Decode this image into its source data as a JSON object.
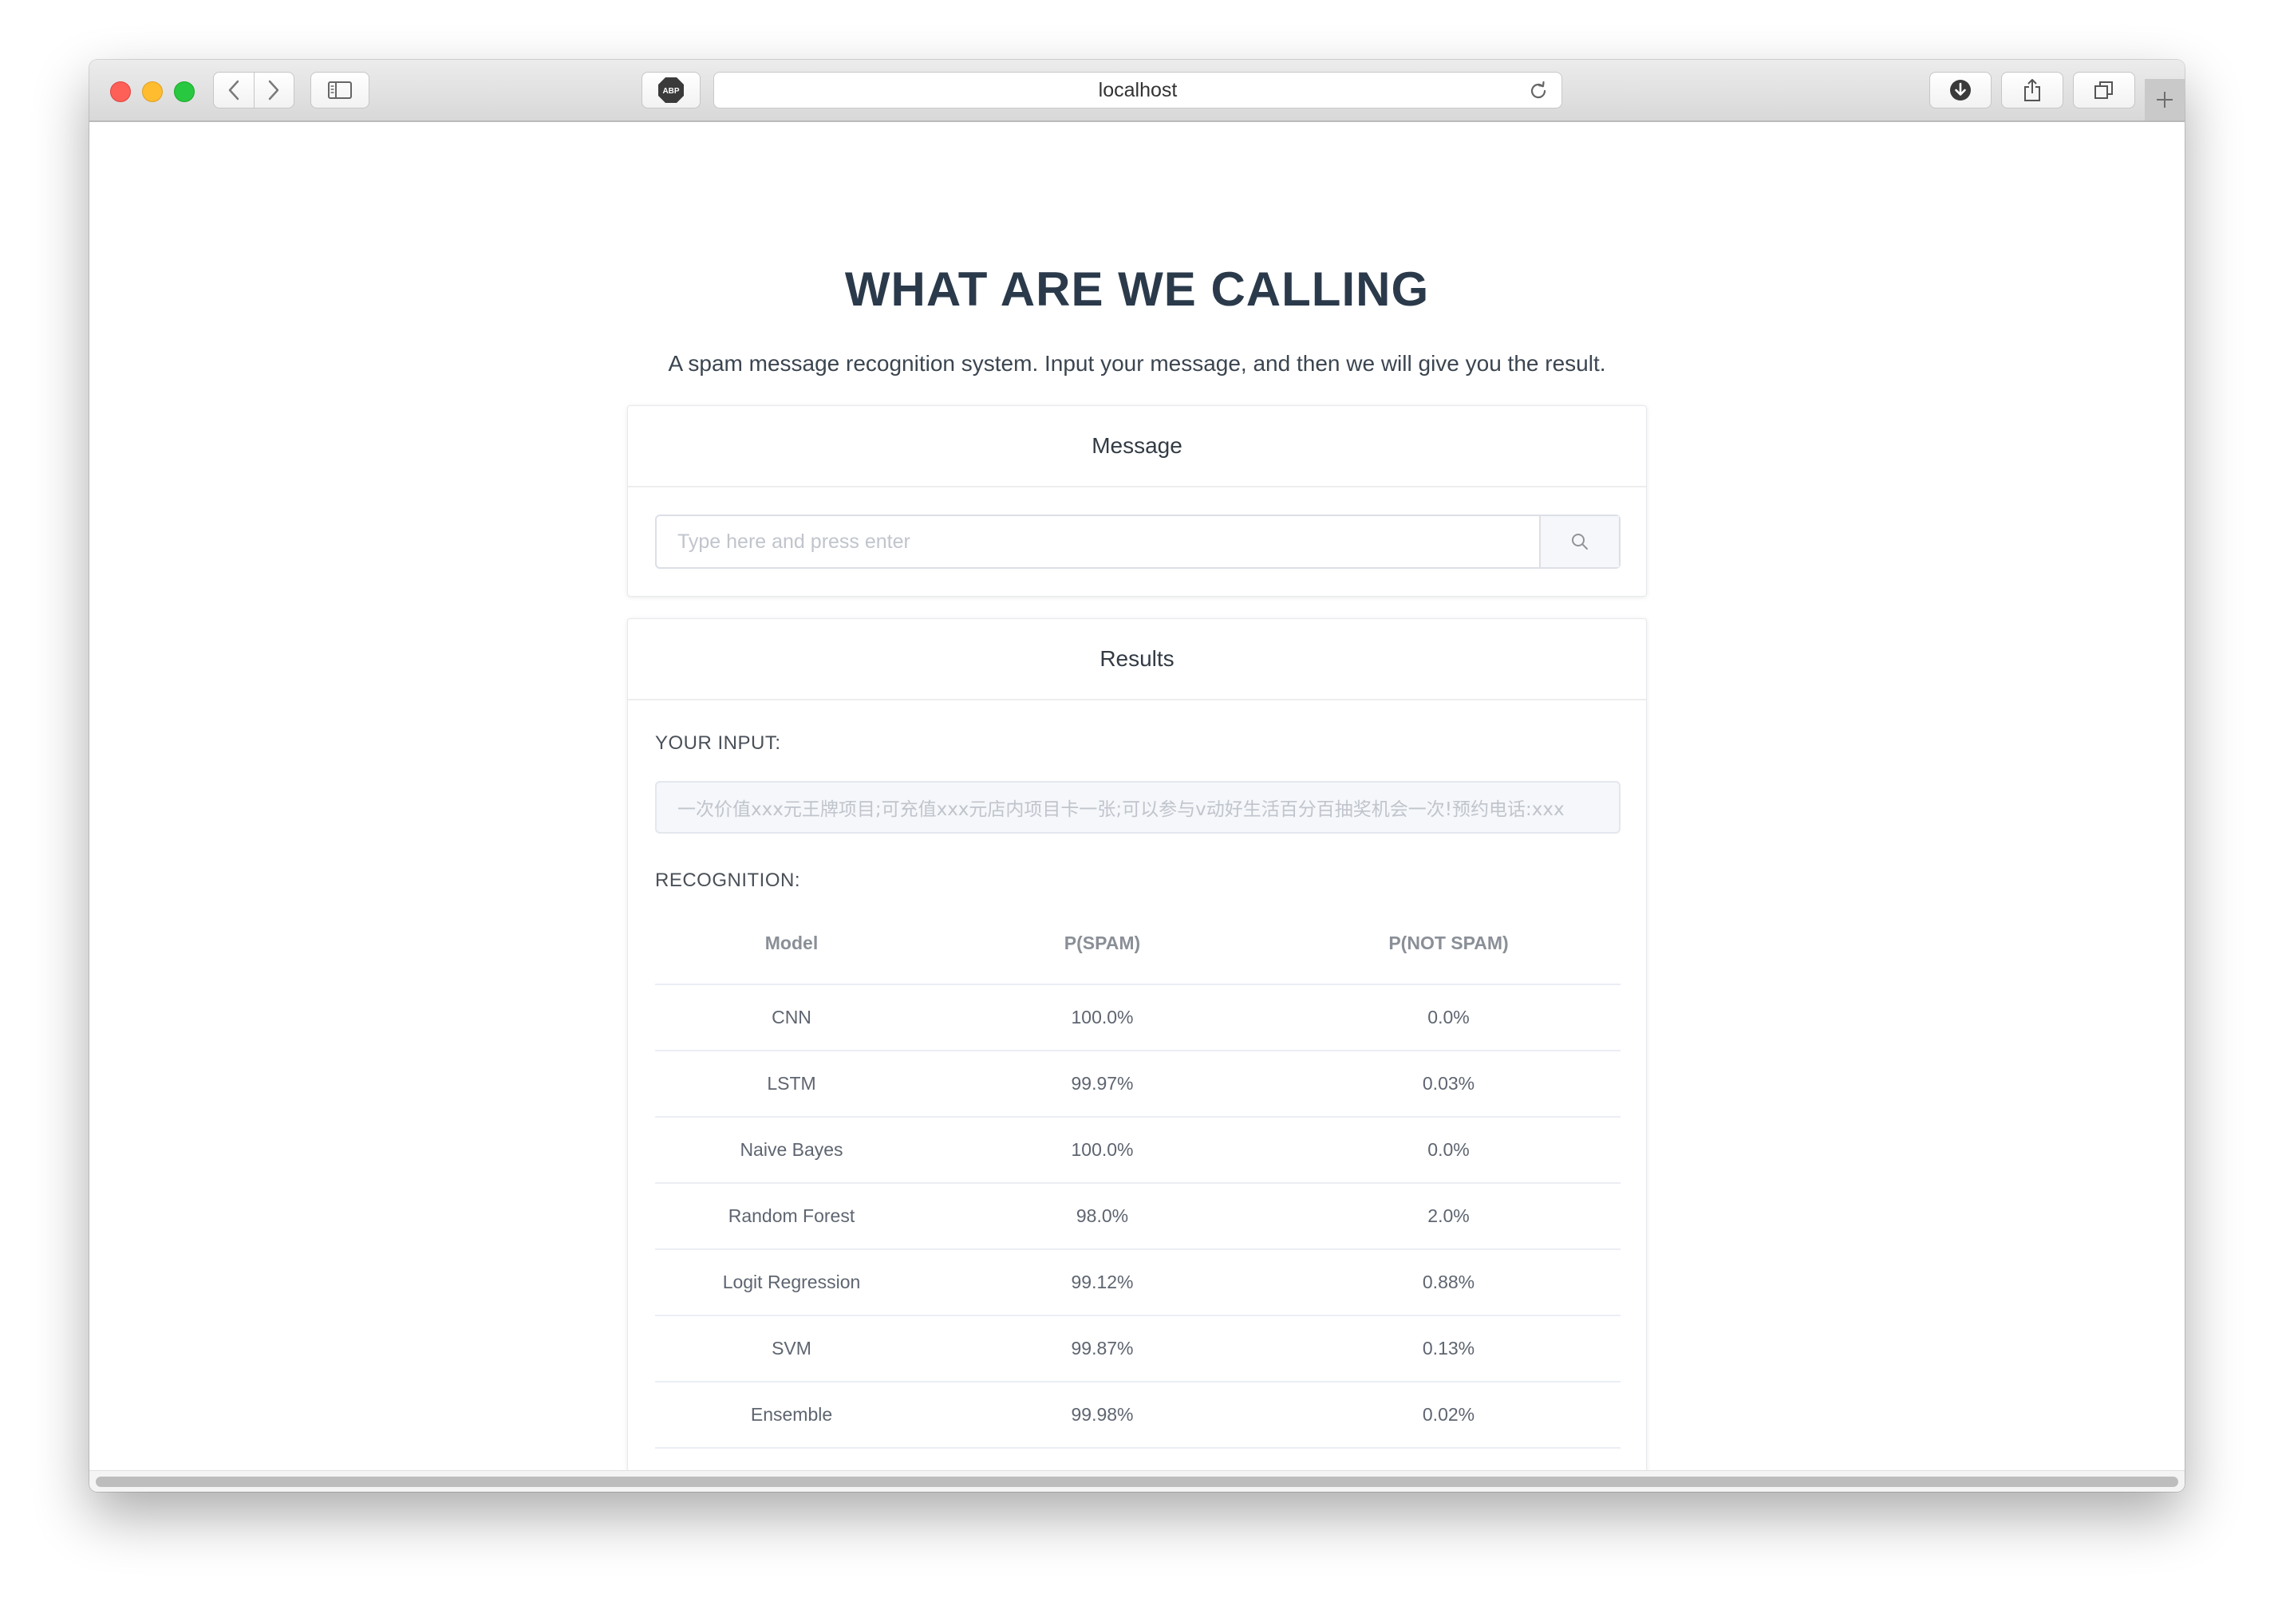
{
  "browser": {
    "url": "localhost",
    "abp_label": "ABP"
  },
  "page": {
    "title": "WHAT ARE WE CALLING",
    "subtitle": "A spam message recognition system. Input your message, and then we will give you the result."
  },
  "message_card": {
    "header": "Message",
    "placeholder": "Type here and press enter",
    "value": ""
  },
  "results_card": {
    "header": "Results",
    "your_input_label": "YOUR INPUT:",
    "your_input_value": "一次价值xxx元王牌项目;可充值xxx元店内项目卡一张;可以参与v动好生活百分百抽奖机会一次!预约电话:xxx",
    "recognition_label": "RECOGNITION:",
    "columns": [
      "Model",
      "P(SPAM)",
      "P(NOT SPAM)"
    ],
    "rows": [
      {
        "model": "CNN",
        "spam": "100.0%",
        "not_spam": "0.0%"
      },
      {
        "model": "LSTM",
        "spam": "99.97%",
        "not_spam": "0.03%"
      },
      {
        "model": "Naive Bayes",
        "spam": "100.0%",
        "not_spam": "0.0%"
      },
      {
        "model": "Random Forest",
        "spam": "98.0%",
        "not_spam": "2.0%"
      },
      {
        "model": "Logit Regression",
        "spam": "99.12%",
        "not_spam": "0.88%"
      },
      {
        "model": "SVM",
        "spam": "99.87%",
        "not_spam": "0.13%"
      },
      {
        "model": "Ensemble",
        "spam": "99.98%",
        "not_spam": "0.02%"
      }
    ]
  }
}
